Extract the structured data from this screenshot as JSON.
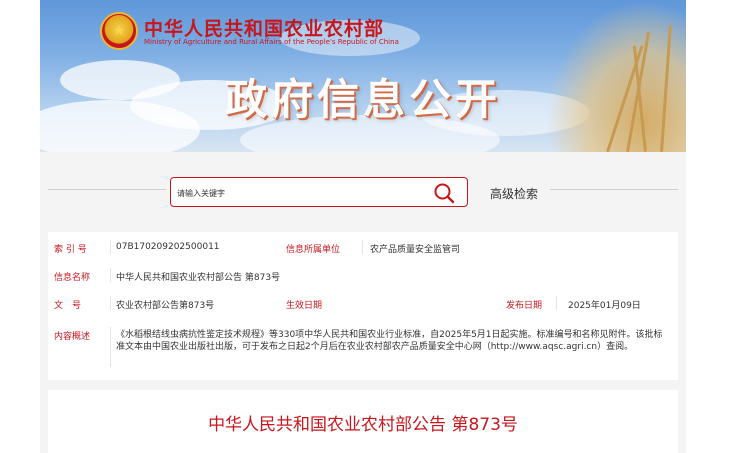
{
  "header": {
    "ministry_name": "中华人民共和国农业农村部",
    "ministry_name_en": "Ministry of Agriculture and Rural Affairs of the People's Republic of China",
    "banner_title": "政府信息公开"
  },
  "search": {
    "placeholder": "请输入关键字",
    "advanced_label": "高级检索",
    "icon": "search-icon"
  },
  "info": {
    "index_label": "索 引 号",
    "index_value": "07B170209202500011",
    "unit_label": "信息所属单位",
    "unit_value": "农产品质量安全监管司",
    "name_label": "信息名称",
    "name_value": "中华人民共和国农业农村部公告 第873号",
    "doc_label": "文　号",
    "doc_value": "农业农村部公告第873号",
    "effective_label": "生效日期",
    "effective_value": "",
    "publish_label": "发布日期",
    "publish_value": "2025年01月09日",
    "summary_label": "内容概述",
    "summary_value": "《水稻根结线虫病抗性鉴定技术规程》等330项中华人民共和国农业行业标准，自2025年5月1日起实施。标准编号和名称见附件。该批标准文本由中国农业出版社出版，可于发布之日起2个月后在农业农村部农产品质量安全中心网（http://www.aqsc.agri.cn）查阅。"
  },
  "notice": {
    "title": "中华人民共和国农业农村部公告 第873号"
  },
  "colors": {
    "brand_red": "#c8161d",
    "background": "#f4f4f4"
  }
}
